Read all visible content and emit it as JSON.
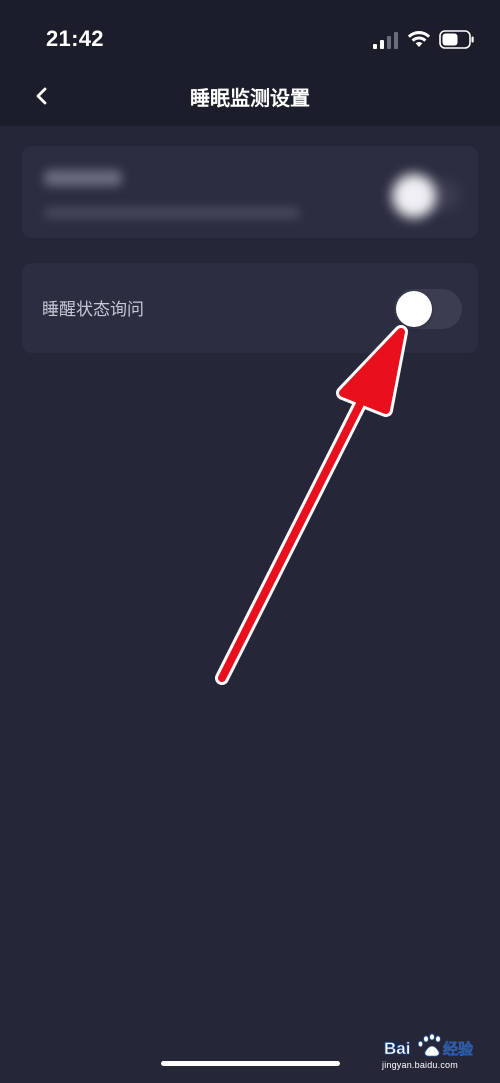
{
  "status_bar": {
    "time": "21:42",
    "signal_icon": "signal-icon",
    "wifi_icon": "wifi-icon",
    "battery_icon": "battery-icon",
    "battery_level_fraction": 0.6
  },
  "nav": {
    "back_icon": "chevron-left-icon",
    "title": "睡眠监测设置"
  },
  "settings": [
    {
      "label": "睡醒状态询问",
      "enabled": false
    }
  ],
  "watermark": {
    "logo_text": "Bai经验",
    "url": "jingyan.baidu.com"
  },
  "colors": {
    "background": "#252739",
    "header": "#1c1d2b",
    "card": "#2b2d40",
    "toggle_track": "#3b3d51",
    "annotation_arrow": "#e8101c"
  }
}
